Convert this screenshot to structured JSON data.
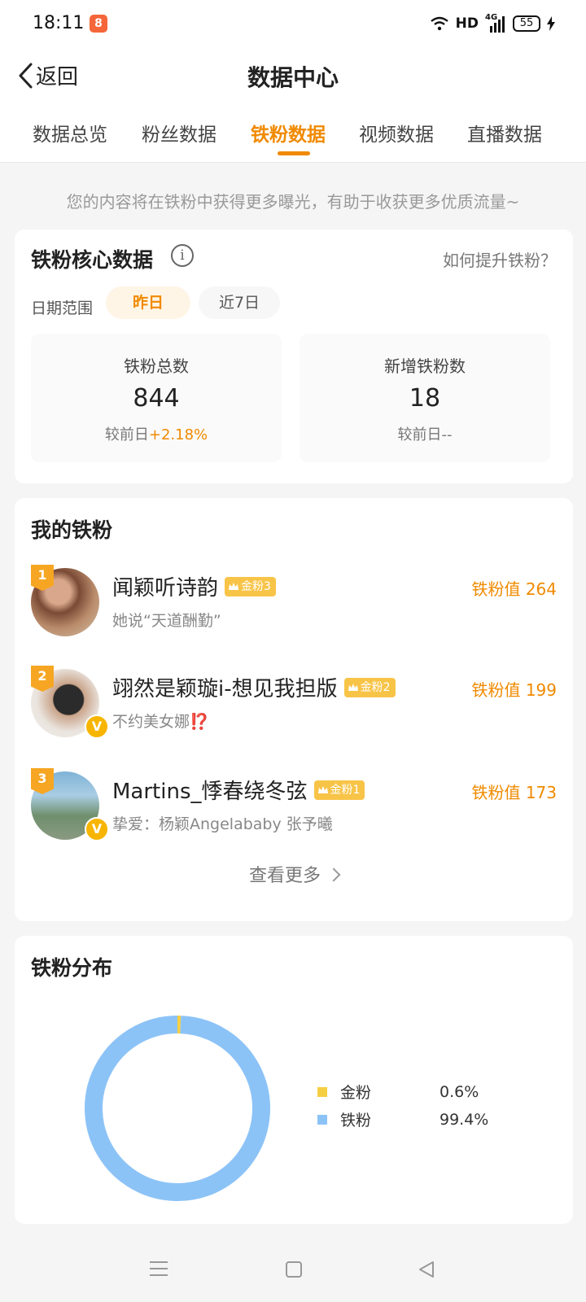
{
  "status_bar": {
    "time": "18:11",
    "network_label": "HD",
    "signal_label": "4G",
    "battery": "55"
  },
  "navbar": {
    "back_label": "返回",
    "title": "数据中心"
  },
  "tabs": [
    {
      "label": "数据总览",
      "active": false
    },
    {
      "label": "粉丝数据",
      "active": false
    },
    {
      "label": "铁粉数据",
      "active": true
    },
    {
      "label": "视频数据",
      "active": false
    },
    {
      "label": "直播数据",
      "active": false
    }
  ],
  "tip": "您的内容将在铁粉中获得更多曝光，有助于收获更多优质流量~",
  "core": {
    "title": "铁粉核心数据",
    "info_icon": "i",
    "help_link": "如何提升铁粉？",
    "date_label": "日期范围",
    "date_options": [
      {
        "label": "昨日",
        "selected": true
      },
      {
        "label": "近7日",
        "selected": false
      }
    ],
    "stats": [
      {
        "label": "铁粉总数",
        "value": "844",
        "compare_prefix": "较前日",
        "compare_value": "+2.18%"
      },
      {
        "label": "新增铁粉数",
        "value": "18",
        "compare_prefix": "较前日",
        "compare_value": "--"
      }
    ]
  },
  "my_fans": {
    "title": "我的铁粉",
    "items": [
      {
        "rank": "1",
        "name": "闻颖听诗韵",
        "level": "金粉3",
        "subtitle": "她说“天道酬勤”",
        "value": "铁粉值 264",
        "verified": false
      },
      {
        "rank": "2",
        "name": "翊然是颖璇i-想见我担版",
        "level": "金粉2",
        "subtitle": "不约美女娜",
        "subtitle_emoji": "⁉️",
        "value": "铁粉值 199",
        "verified": true
      },
      {
        "rank": "3",
        "name": "Martins_悸春绕冬弦",
        "level": "金粉1",
        "subtitle": "挚爱：杨颖Angelababy 张予曦",
        "value": "铁粉值 173",
        "verified": true
      }
    ],
    "see_more": "查看更多"
  },
  "distribution": {
    "title": "铁粉分布",
    "legend": [
      {
        "name": "金粉",
        "percent": "0.6%",
        "value": 0.6,
        "color": "#f5cf43"
      },
      {
        "name": "铁粉",
        "percent": "99.4%",
        "value": 99.4,
        "color": "#8cc3f7"
      }
    ]
  },
  "colors": {
    "accent": "#f08a00",
    "gold_tag": "#f8c448"
  },
  "icons": {
    "back": "chevron-left-icon",
    "info": "info-circle-icon",
    "more": "chevron-right-icon",
    "crown": "crown-icon",
    "verified": "v-badge-icon"
  }
}
